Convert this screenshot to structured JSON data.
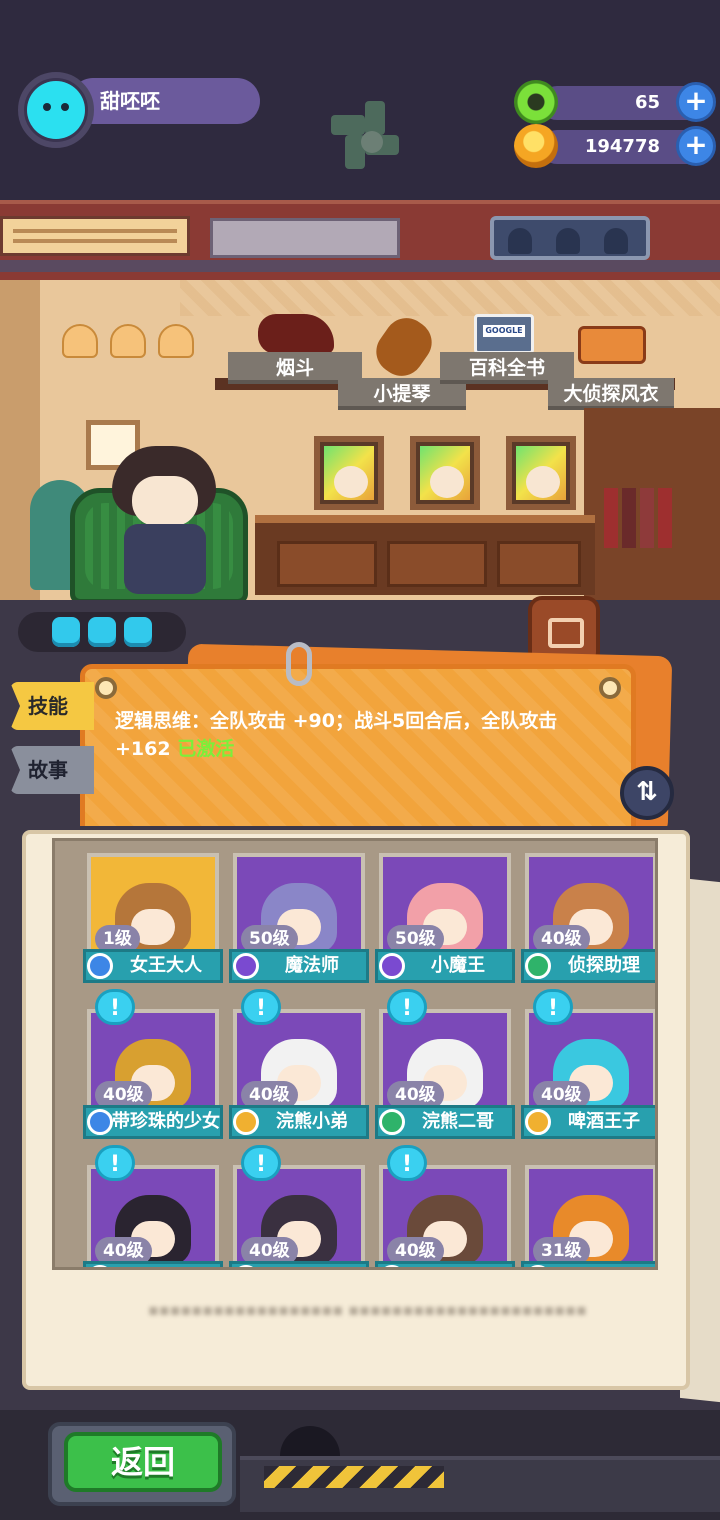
{
  "player": {
    "name": "甜呸呸"
  },
  "resources": {
    "donut": {
      "icon": "donut-icon",
      "value": "65"
    },
    "coins": {
      "icon": "planet-coin-icon",
      "value": "194778"
    }
  },
  "room_items": [
    {
      "label": "烟斗",
      "icon": "pipe-icon"
    },
    {
      "label": "小提琴",
      "icon": "violin-icon"
    },
    {
      "label": "百科全书",
      "icon": "encyclopedia-icon",
      "brand": "GOOGLE"
    },
    {
      "label": "大侦探风衣",
      "icon": "coat-icon"
    }
  ],
  "energy_count": 3,
  "tabs": {
    "skill": "技能",
    "story": "故事"
  },
  "skill": {
    "text": "逻辑思维：全队攻击 +90；战斗5回合后，全队攻击 +162",
    "status": "已激活"
  },
  "cards": [
    {
      "level": "1级",
      "name": "女王大人",
      "alert": false,
      "bg": "gold",
      "badge_color": "#3d86e6",
      "hair": "#b5763a"
    },
    {
      "level": "50级",
      "name": "魔法师",
      "alert": false,
      "bg": "purple",
      "badge_color": "#7a4ad0",
      "hair": "#8a86c8"
    },
    {
      "level": "50级",
      "name": "小魔王",
      "alert": false,
      "bg": "purple",
      "badge_color": "#7a4ad0",
      "hair": "#f2a0a8"
    },
    {
      "level": "40级",
      "name": "侦探助理",
      "alert": false,
      "bg": "purple",
      "badge_color": "#2fb36a",
      "hair": "#c9814a"
    },
    {
      "level": "40级",
      "name": "带珍珠的少女",
      "alert": true,
      "bg": "purple",
      "badge_color": "#3d86e6",
      "hair": "#d8a030"
    },
    {
      "level": "40级",
      "name": "浣熊小弟",
      "alert": true,
      "bg": "purple",
      "badge_color": "#f0b030",
      "hair": "#f2f2f2"
    },
    {
      "level": "40级",
      "name": "浣熊二哥",
      "alert": true,
      "bg": "purple",
      "badge_color": "#2fb36a",
      "hair": "#f2f2f2"
    },
    {
      "level": "40级",
      "name": "啤酒王子",
      "alert": true,
      "bg": "purple",
      "badge_color": "#f0b030",
      "hair": "#3ac8e0"
    },
    {
      "level": "40级",
      "name": "",
      "alert": true,
      "bg": "purple",
      "badge_color": "#7a4ad0",
      "hair": "#2a2430"
    },
    {
      "level": "40级",
      "name": "",
      "alert": true,
      "bg": "purple",
      "badge_color": "#2fb36a",
      "hair": "#3a3040"
    },
    {
      "level": "40级",
      "name": "",
      "alert": true,
      "bg": "purple",
      "badge_color": "#e05a3a",
      "hair": "#6a4a3a"
    },
    {
      "level": "31级",
      "name": "",
      "alert": false,
      "bg": "purple",
      "badge_color": "#e05a3a",
      "hair": "#e88a2a"
    }
  ],
  "back_button": "返回",
  "colors": {
    "accent_gold": "#f5c842",
    "panel_orange": "#f2a43c",
    "status_green": "#7bf03a",
    "name_bar": "#28a0ae",
    "button_green": "#3cc04a"
  }
}
